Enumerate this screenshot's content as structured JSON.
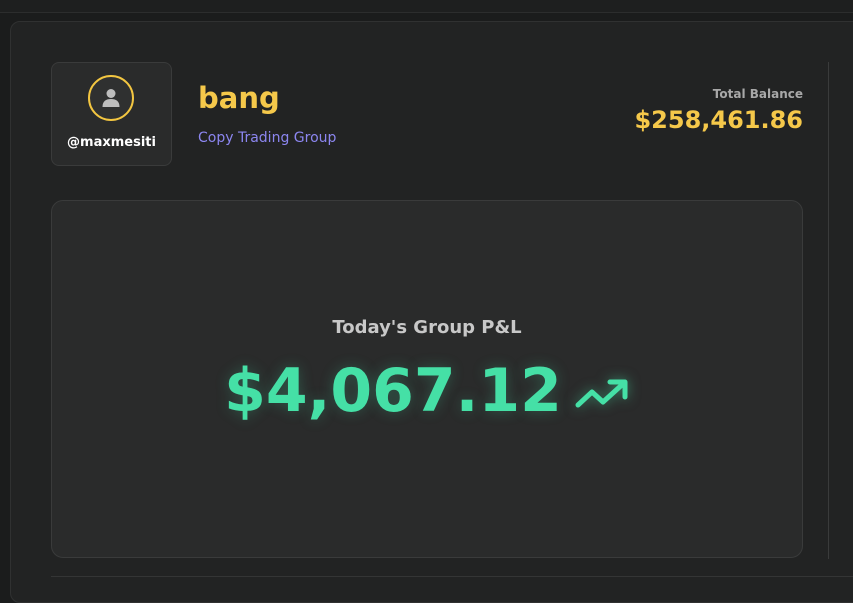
{
  "profile": {
    "avatar_icon": "user-icon",
    "username": "@maxmesiti",
    "accent_color": "#f3c641"
  },
  "group": {
    "name": "bang",
    "type": "Copy Trading Group"
  },
  "balance": {
    "label": "Total Balance",
    "value": "$258,461.86"
  },
  "pnl": {
    "label": "Today's Group P&L",
    "value": "$4,067.12",
    "trend_icon": "trending-up-icon",
    "color": "#45e0a6"
  }
}
